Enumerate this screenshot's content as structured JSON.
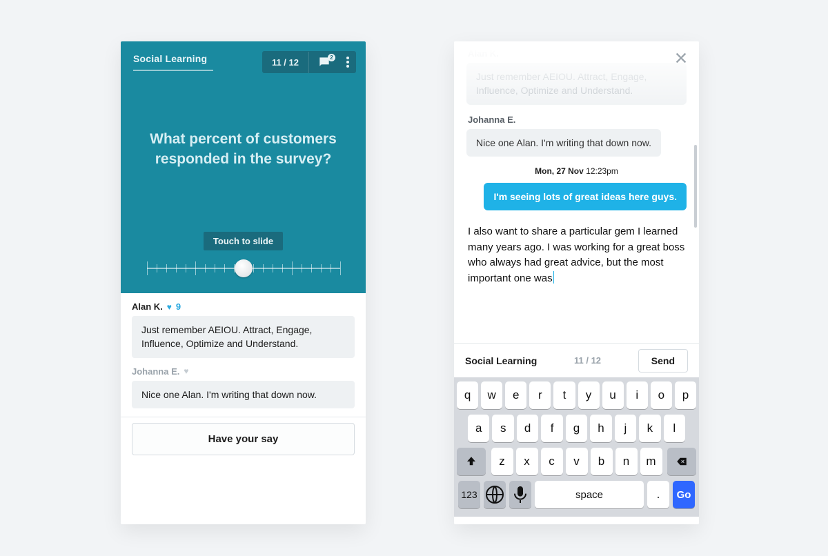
{
  "left": {
    "header": {
      "title": "Social Learning",
      "counter": "11 / 12",
      "chat_badge": "2"
    },
    "question": "What percent of customers responded in the survey?",
    "slider_label": "Touch to slide",
    "comments": [
      {
        "author": "Alan K.",
        "likes": 9,
        "liked": true,
        "text": "Just remember AEIOU. Attract, Engage, Influence, Optimize and Understand."
      },
      {
        "author": "Johanna E.",
        "likes": null,
        "liked": false,
        "text": "Nice one Alan. I'm writing that down now."
      }
    ],
    "cta": "Have your say"
  },
  "right": {
    "close_label": "Close",
    "messages": {
      "faded_author": "Alan K.",
      "faded_text": "Just remember AEIOU. Attract, Engage, Influence, Optimize and Understand.",
      "second_author": "Johanna E.",
      "second_text": "Nice one Alan. I'm writing that down now.",
      "timestamp_day": "Mon, 27 Nov",
      "timestamp_time": "12:23pm",
      "own_text": "I'm seeing lots of great ideas here guys."
    },
    "compose_text": "I also want to share a particular gem I learned many years ago. I was working for a great boss who always had great advice, but the most important one was",
    "bar": {
      "title": "Social Learning",
      "counter": "11 / 12",
      "send": "Send"
    },
    "keyboard": {
      "row1": [
        "q",
        "w",
        "e",
        "r",
        "t",
        "y",
        "u",
        "i",
        "o",
        "p"
      ],
      "row2": [
        "a",
        "s",
        "d",
        "f",
        "g",
        "h",
        "j",
        "k",
        "l"
      ],
      "row3": [
        "z",
        "x",
        "c",
        "v",
        "b",
        "n",
        "m"
      ],
      "num": "123",
      "space": "space",
      "dot": ".",
      "go": "Go"
    }
  }
}
